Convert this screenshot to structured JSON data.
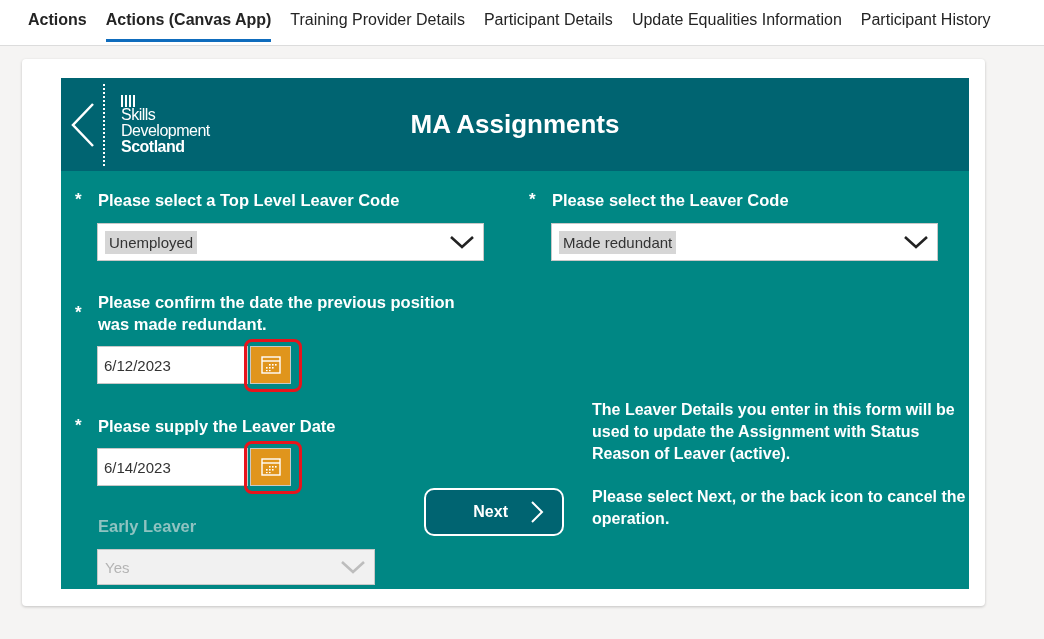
{
  "tabs": [
    {
      "label": "Actions",
      "selected": false,
      "bold": true
    },
    {
      "label": "Actions (Canvas App)",
      "selected": true,
      "bold": true
    },
    {
      "label": "Training Provider Details",
      "selected": false,
      "bold": false
    },
    {
      "label": "Participant Details",
      "selected": false,
      "bold": false
    },
    {
      "label": "Update Equalities Information",
      "selected": false,
      "bold": false
    },
    {
      "label": "Participant History",
      "selected": false,
      "bold": false
    }
  ],
  "app": {
    "title": "MA Assignments",
    "logo": {
      "lines": [
        "Skills",
        "Development",
        "Scotland"
      ]
    }
  },
  "top_fields": [
    {
      "kind": "dropdown",
      "marker": "*",
      "label": "Please select a Top Level Leaver Code",
      "value": "Unemployed",
      "disabled": false
    },
    {
      "kind": "dropdown",
      "marker": "*",
      "label": "Please select the Leaver Code",
      "value": "Made redundant",
      "disabled": false
    }
  ],
  "left_fields": [
    {
      "kind": "date",
      "marker": "*",
      "label": "Please confirm the date the previous position was made redundant.",
      "value": "6/12/2023",
      "highlighted": true
    },
    {
      "kind": "date",
      "marker": "*",
      "label": "Please supply the Leaver Date",
      "value": "6/14/2023",
      "highlighted": true
    },
    {
      "kind": "dropdown",
      "label": "Early Leaver",
      "value": "Yes",
      "disabled": true
    }
  ],
  "next_button": {
    "label": "Next"
  },
  "info": [
    "The Leaver Details you enter in this form will be used to update the Assignment with Status Reason of Leaver (active).",
    "Please select Next, or the back icon to cancel the operation."
  ]
}
